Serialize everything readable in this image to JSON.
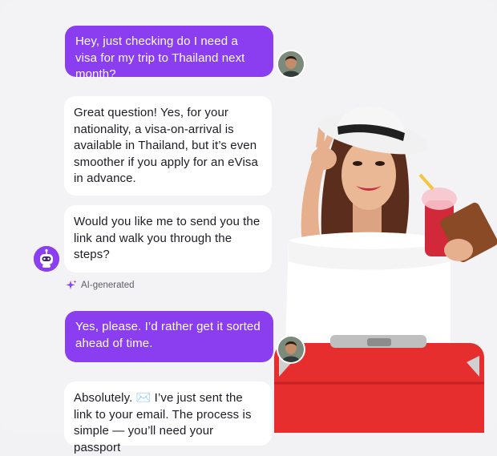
{
  "messages": [
    {
      "role": "user",
      "text": "Hey, just checking  do I need a visa for my trip to Thailand next month?"
    },
    {
      "role": "bot",
      "text": "Great question! Yes, for your nationality, a visa-on-arrival is available in Thailand, but it’s even smoother if you apply for an eVisa in advance."
    },
    {
      "role": "bot",
      "text": "Would you like me to send you the link and walk you through the steps?"
    },
    {
      "role": "user",
      "text": "Yes, please. I’d rather get it sorted ahead of time."
    },
    {
      "role": "bot",
      "text": "Absolutely. ✉️ I’ve just sent the link to your email. The process is simple — you’ll need your passport"
    }
  ],
  "ai_label": "AI-generated",
  "colors": {
    "user_bubble": "#8a3ef0",
    "bot_bubble": "#ffffff",
    "background": "#f3f3f6",
    "accent": "#8b3ff0"
  },
  "icons": {
    "user_avatar": "user-avatar-photo",
    "bot_avatar": "robot-avatar-icon",
    "ai_tag": "sparkle-icon"
  }
}
